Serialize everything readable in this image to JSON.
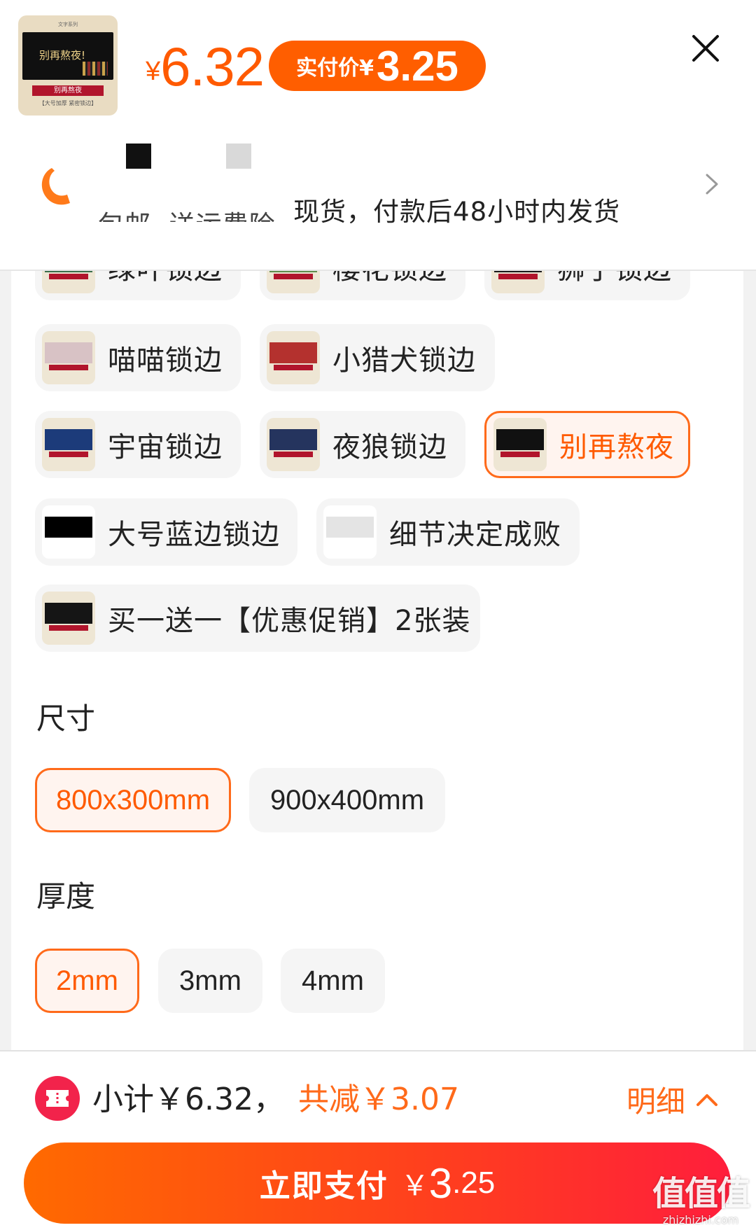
{
  "header": {
    "thumbnail": {
      "top_text": "文字系列",
      "screen_text": "别再熬夜!",
      "band_text": "别再熬夜",
      "sub_text": "【大号加厚 紧密锁边】"
    },
    "price": {
      "symbol": "¥",
      "value": "6.32"
    },
    "pay_pill": {
      "label": "实付价¥",
      "value": "3.25"
    },
    "close_icon": "close-icon"
  },
  "shipping": {
    "icon": "shipping-icon",
    "part1": "包邮",
    "part2": "送运费险",
    "part3": "现货，付款后48小时内发货"
  },
  "styles": {
    "options": [
      {
        "label": "绿叶锁边",
        "color": "#3b6e4a"
      },
      {
        "label": "樱花锁边",
        "color": "#5f8c4c"
      },
      {
        "label": "狮子锁边",
        "color": "#1a1a1a"
      },
      {
        "label": "喵喵锁边",
        "color": "#d8c2c5"
      },
      {
        "label": "小猎犬锁边",
        "color": "#b4312e"
      },
      {
        "label": "宇宙锁边",
        "color": "#1c3b7a"
      },
      {
        "label": "夜狼锁边",
        "color": "#25345e"
      },
      {
        "label": "别再熬夜",
        "color": "#111111",
        "selected": true
      },
      {
        "label": "大号蓝边锁边",
        "color": "#000000"
      },
      {
        "label": "细节决定成败",
        "color": "#f0f0f0"
      },
      {
        "label": "买一送一【优惠促销】2张装",
        "color": "#151515"
      }
    ]
  },
  "size": {
    "title": "尺寸",
    "options": [
      "800x300mm",
      "900x400mm"
    ],
    "selected": "800x300mm"
  },
  "thickness": {
    "title": "厚度",
    "options": [
      "2mm",
      "3mm",
      "4mm"
    ],
    "selected": "2mm"
  },
  "footer": {
    "subtotal": "小计￥6.32，",
    "discount": "共减￥3.07",
    "detail_label": "明细",
    "pay_label": "立即支付",
    "pay_yen": "￥",
    "pay_int": "3",
    "pay_dec": ".25"
  },
  "watermark": {
    "main": "值值值",
    "sub": "zhizhizhi.com"
  },
  "colors": {
    "accent": "#ff5a00",
    "selected_bg": "#fff4ef",
    "chip_bg": "#f5f5f5",
    "coupon": "#f2234b"
  }
}
